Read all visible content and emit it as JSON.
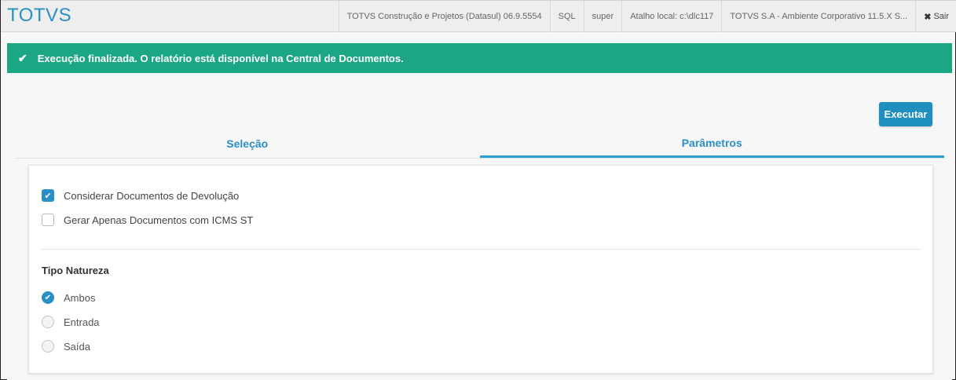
{
  "header": {
    "logo": "TOTVS",
    "items": [
      "TOTVS Construção e Projetos (Datasul) 06.9.5554",
      "SQL",
      "super",
      "Atalho local: c:\\dlc117",
      "TOTVS S.A - Ambiente Corporativo 11.5.X S..."
    ],
    "logout_icon": "close-icon",
    "logout_label": "Sair"
  },
  "banner": {
    "icon": "check-icon",
    "message": "Execução finalizada. O relatório está disponível na Central de Documentos.",
    "color": "#1ca784"
  },
  "actions": {
    "execute_label": "Executar"
  },
  "tabs": [
    {
      "label": "Seleção",
      "active": false
    },
    {
      "label": "Parâmetros",
      "active": true
    }
  ],
  "parameters": {
    "checkboxes": [
      {
        "label": "Considerar Documentos de Devolução",
        "checked": true
      },
      {
        "label": "Gerar Apenas Documentos com ICMS ST",
        "checked": false
      }
    ],
    "tipo_natureza": {
      "label": "Tipo Natureza",
      "options": [
        {
          "label": "Ambos",
          "selected": true
        },
        {
          "label": "Entrada",
          "selected": false
        },
        {
          "label": "Saída",
          "selected": false
        }
      ]
    }
  },
  "colors": {
    "accent": "#2a8fc7",
    "success": "#1ca784",
    "button": "#1f8fbf"
  }
}
